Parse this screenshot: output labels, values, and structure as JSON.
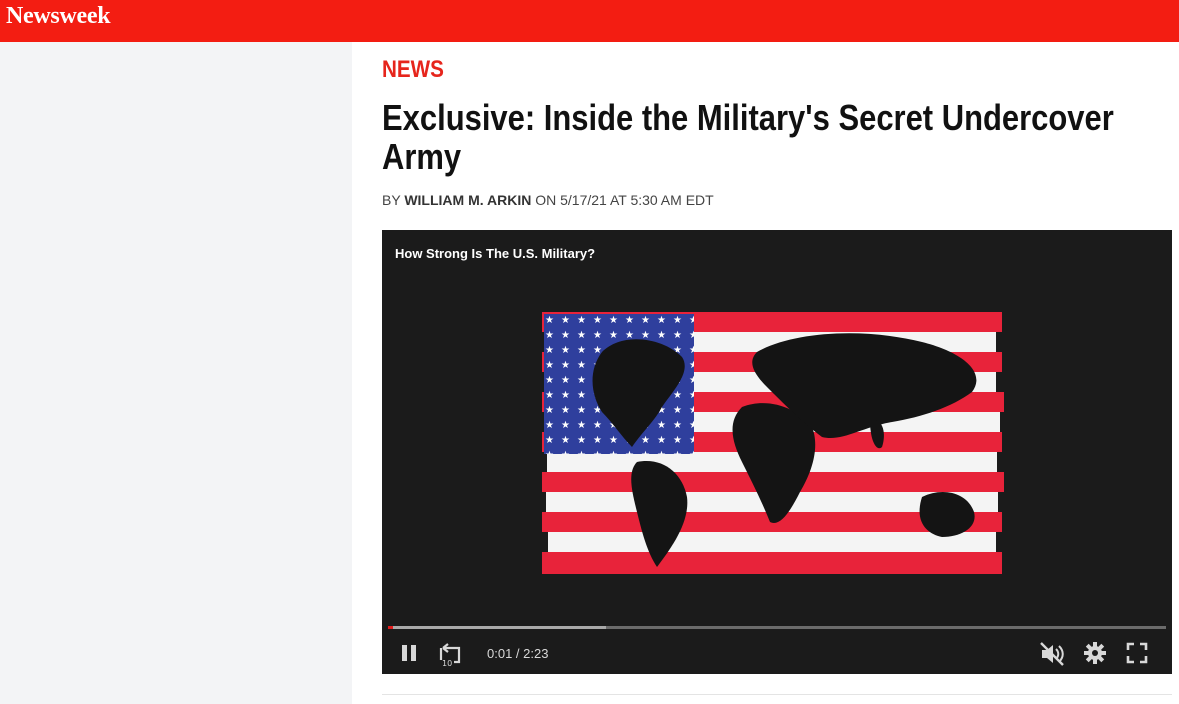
{
  "header": {
    "logo_text": "Newsweek",
    "brand_color": "#f31d12"
  },
  "article": {
    "section": "NEWS",
    "headline": "Exclusive: Inside the Military's Secret Undercover Army",
    "byline": {
      "by": "BY",
      "author": "WILLIAM M. ARKIN",
      "date_text": "ON 5/17/21 AT 5:30 AM EDT"
    }
  },
  "video": {
    "title": "How Strong Is The U.S. Military?",
    "current_time": "0:01",
    "duration": "2:23",
    "time_separator": " / ",
    "played_fraction": 0.007,
    "buffered_fraction": 0.28,
    "controls": {
      "pause_icon": "pause-icon",
      "replay10_icon": "replay-10-icon",
      "mute_icon": "volume-muted-icon",
      "settings_icon": "gear-icon",
      "fullscreen_icon": "fullscreen-icon",
      "replay_label": "10"
    },
    "accent_color": "#e21c1c"
  }
}
